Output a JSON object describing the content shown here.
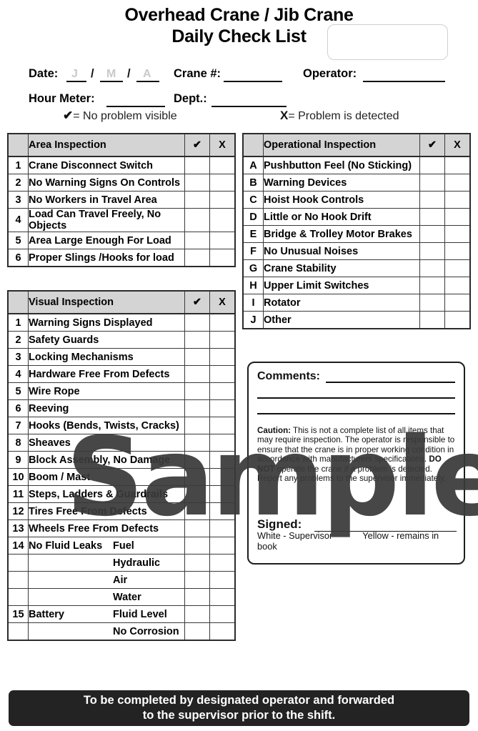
{
  "header": {
    "title_line1": "Overhead Crane / Jib Crane",
    "title_line2": "Daily Check List",
    "logo_box_label": ""
  },
  "fields": {
    "date_label": "Date:",
    "date_d": "J",
    "date_m": "M",
    "date_y": "A",
    "sep": "/",
    "crane_label": "Crane #:",
    "crane_value": "",
    "operator_label": "Operator:",
    "operator_value": "",
    "hour_meter_label": "Hour Meter:",
    "hour_meter_value": "",
    "dept_label": "Dept.:",
    "dept_value": ""
  },
  "legend": {
    "check_glyph": "✔",
    "check_text": "= No problem visible",
    "x_glyph": "X",
    "x_text": "= Problem is detected"
  },
  "tables": {
    "area": {
      "title": "Area Inspection",
      "col_check": "✔",
      "col_x": "X",
      "rows": [
        {
          "num": "1",
          "item": "Crane Disconnect Switch",
          "small": false
        },
        {
          "num": "2",
          "item": "No Warning Signs On Controls",
          "small": true
        },
        {
          "num": "3",
          "item": "No Workers in Travel Area",
          "small": false
        },
        {
          "num": "4",
          "item": "Load Can Travel Freely, No Objects",
          "small": true
        },
        {
          "num": "5",
          "item": "Area Large Enough For Load",
          "small": false
        },
        {
          "num": "6",
          "item": "Proper Slings /Hooks for load",
          "small": false
        }
      ]
    },
    "visual": {
      "title": "Visual Inspection",
      "col_check": "✔",
      "col_x": "X",
      "rows": [
        {
          "num": "1",
          "item": "Warning Signs Displayed",
          "sub": ""
        },
        {
          "num": "2",
          "item": "Safety Guards",
          "sub": ""
        },
        {
          "num": "3",
          "item": "Locking Mechanisms",
          "sub": ""
        },
        {
          "num": "4",
          "item": "Hardware Free From Defects",
          "sub": ""
        },
        {
          "num": "5",
          "item": "Wire Rope",
          "sub": ""
        },
        {
          "num": "6",
          "item": "Reeving",
          "sub": ""
        },
        {
          "num": "7",
          "item": "Hooks (Bends, Twists, Cracks)",
          "sub": ""
        },
        {
          "num": "8",
          "item": "Sheaves",
          "sub": ""
        },
        {
          "num": "9",
          "item": "Block Assembly, No Damage",
          "sub": ""
        },
        {
          "num": "10",
          "item": "Boom / Mast",
          "sub": ""
        },
        {
          "num": "11",
          "item": "Steps, Ladders & Guardrails",
          "sub": ""
        },
        {
          "num": "12",
          "item": "Tires Free From Defects",
          "sub": ""
        },
        {
          "num": "13",
          "item": "Wheels Free From Defects",
          "sub": ""
        },
        {
          "num": "14",
          "item": "No Fluid Leaks",
          "sub": "Fuel"
        },
        {
          "num": "",
          "item": "",
          "sub": "Hydraulic"
        },
        {
          "num": "",
          "item": "",
          "sub": "Air"
        },
        {
          "num": "",
          "item": "",
          "sub": "Water"
        },
        {
          "num": "15",
          "item": "Battery",
          "sub": "Fluid Level"
        },
        {
          "num": "",
          "item": "",
          "sub": "No Corrosion"
        }
      ]
    },
    "operational": {
      "title": "Operational Inspection",
      "col_check": "✔",
      "col_x": "X",
      "rows": [
        {
          "num": "A",
          "item": "Pushbutton Feel (No Sticking)"
        },
        {
          "num": "B",
          "item": "Warning Devices"
        },
        {
          "num": "C",
          "item": "Hoist Hook Controls"
        },
        {
          "num": "D",
          "item": "Little or No Hook Drift"
        },
        {
          "num": "E",
          "item": "Bridge & Trolley Motor Brakes"
        },
        {
          "num": "F",
          "item": "No Unusual Noises"
        },
        {
          "num": "G",
          "item": "Crane Stability"
        },
        {
          "num": "H",
          "item": "Upper Limit Switches"
        },
        {
          "num": "I",
          "item": "Rotator"
        },
        {
          "num": "J",
          "item": "Other"
        }
      ]
    }
  },
  "comments_panel": {
    "comments_label": "Comments:",
    "comments_value": "",
    "caution_label": "Caution:",
    "caution_text": " This is not a complete list of all items that may require inspection. The operator is responsible to ensure that the crane is in proper working condition in accordance with manufacturers specifications. ",
    "caution_bold2": "DO NOT",
    "caution_text2": " operate the crane if a problem is detected. Report any problems to the supervisor immediately.",
    "signed_label": "Signed:",
    "signed_value": "",
    "copy_white": "White - Supervisor",
    "copy_yellow": "Yellow - remains in book"
  },
  "footer": {
    "line1": "To be completed by designated operator and forwarded",
    "line2": "to the supervisor prior to the shift."
  },
  "watermark": {
    "text": "Sample"
  },
  "colors": {
    "header_fill": "#d4d4d4",
    "border": "#2b2b2b",
    "footer_bg": "#232323",
    "faint_text": "#c9c9c9"
  }
}
